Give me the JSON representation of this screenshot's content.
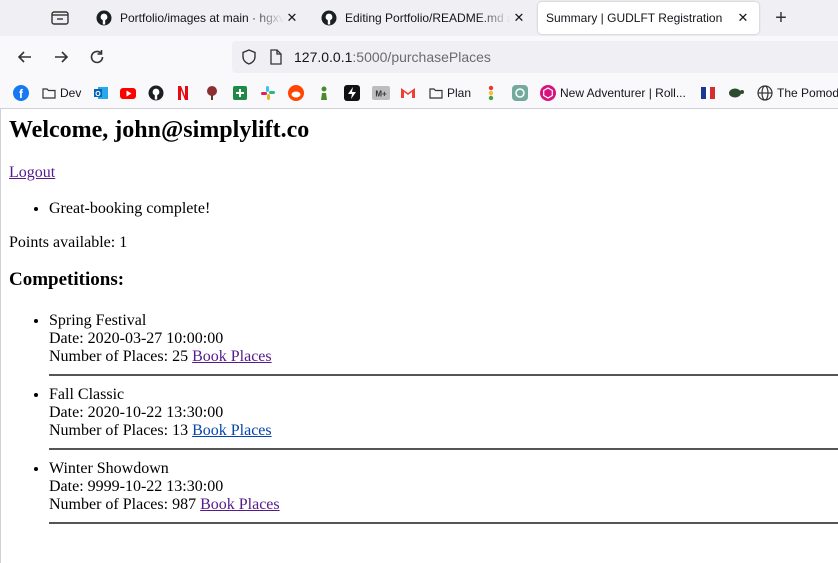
{
  "browser": {
    "tabs": [
      {
        "title": "Portfolio/images at main · hgxv",
        "icon": "github-icon",
        "active": false
      },
      {
        "title": "Editing Portfolio/README.md at",
        "icon": "github-icon",
        "active": false
      },
      {
        "title": "Summary | GUDLFT Registration",
        "icon": "none",
        "active": true
      }
    ],
    "url": {
      "host": "127.0.0.1",
      "rest": ":5000/purchasePlaces"
    },
    "bookmarks": [
      {
        "label": "",
        "icon": "facebook-icon"
      },
      {
        "label": "Dev",
        "icon": "folder-icon"
      },
      {
        "label": "",
        "icon": "outlook-icon"
      },
      {
        "label": "",
        "icon": "youtube-icon"
      },
      {
        "label": "",
        "icon": "github-icon"
      },
      {
        "label": "",
        "icon": "netflix-icon"
      },
      {
        "label": "",
        "icon": "tree-icon"
      },
      {
        "label": "",
        "icon": "plus-square-icon"
      },
      {
        "label": "",
        "icon": "slack-icon"
      },
      {
        "label": "",
        "icon": "reddit-icon"
      },
      {
        "label": "",
        "icon": "chess-icon"
      },
      {
        "label": "",
        "icon": "bolt-icon"
      },
      {
        "label": "",
        "icon": "mplus-icon"
      },
      {
        "label": "",
        "icon": "gmail-icon"
      },
      {
        "label": "Plan",
        "icon": "folder-icon"
      },
      {
        "label": "",
        "icon": "traffic-light-icon"
      },
      {
        "label": "",
        "icon": "openai-icon"
      },
      {
        "label": "New Adventurer | Roll...",
        "icon": "dice-icon"
      },
      {
        "label": "",
        "icon": "flag-icon"
      },
      {
        "label": "",
        "icon": "turtle-icon"
      },
      {
        "label": "The Pomod",
        "icon": "globe-icon"
      }
    ]
  },
  "page": {
    "welcome": "Welcome, john@simplylift.co",
    "logout": "Logout",
    "flash_messages": [
      "Great-booking complete!"
    ],
    "points_label": "Points available: 1",
    "competitions_heading": "Competitions:",
    "competitions": [
      {
        "name": "Spring Festival",
        "date": "Date: 2020-03-27 10:00:00",
        "places": "Number of Places: 25",
        "link": "Book Places"
      },
      {
        "name": "Fall Classic",
        "date": "Date: 2020-10-22 13:30:00",
        "places": "Number of Places: 13",
        "link": "Book Places"
      },
      {
        "name": "Winter Showdown",
        "date": "Date: 9999-10-22 13:30:00",
        "places": "Number of Places: 987",
        "link": "Book Places"
      }
    ]
  }
}
